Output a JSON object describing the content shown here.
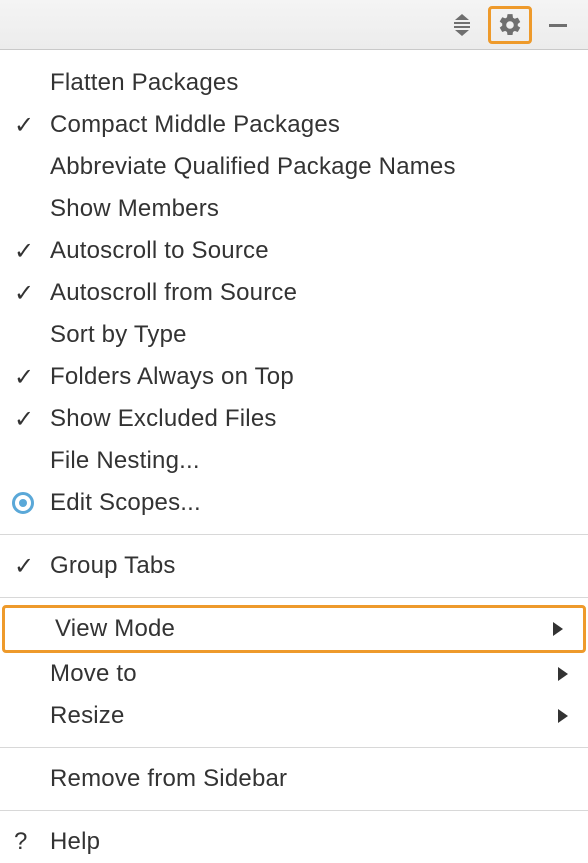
{
  "menu": {
    "section1": [
      {
        "label": "Flatten Packages",
        "checked": false
      },
      {
        "label": "Compact Middle Packages",
        "checked": true
      },
      {
        "label": "Abbreviate Qualified Package Names",
        "checked": false
      },
      {
        "label": "Show Members",
        "checked": false
      },
      {
        "label": "Autoscroll to Source",
        "checked": true
      },
      {
        "label": "Autoscroll from Source",
        "checked": true
      },
      {
        "label": "Sort by Type",
        "checked": false
      },
      {
        "label": "Folders Always on Top",
        "checked": true
      },
      {
        "label": "Show Excluded Files",
        "checked": true
      },
      {
        "label": "File Nesting...",
        "checked": false
      },
      {
        "label": "Edit Scopes...",
        "radio": true
      }
    ],
    "section2": [
      {
        "label": "Group Tabs",
        "checked": true
      }
    ],
    "section3": [
      {
        "label": "View Mode",
        "submenu": true,
        "highlight": true
      },
      {
        "label": "Move to",
        "submenu": true
      },
      {
        "label": "Resize",
        "submenu": true
      }
    ],
    "section4": [
      {
        "label": "Remove from Sidebar"
      }
    ],
    "section5": [
      {
        "label": "Help",
        "help": true
      }
    ]
  }
}
